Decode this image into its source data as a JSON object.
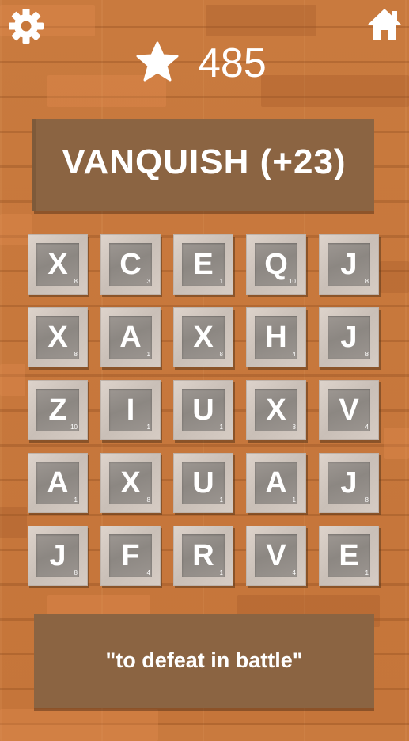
{
  "header": {
    "score": "485"
  },
  "word": {
    "text": "VANQUISH (+23)"
  },
  "hint": {
    "text": "\"to defeat in battle\""
  },
  "grid": [
    [
      {
        "letter": "X",
        "points": "8"
      },
      {
        "letter": "C",
        "points": "3"
      },
      {
        "letter": "E",
        "points": "1"
      },
      {
        "letter": "Q",
        "points": "10"
      },
      {
        "letter": "J",
        "points": "8"
      }
    ],
    [
      {
        "letter": "X",
        "points": "8"
      },
      {
        "letter": "A",
        "points": "1"
      },
      {
        "letter": "X",
        "points": "8"
      },
      {
        "letter": "H",
        "points": "4"
      },
      {
        "letter": "J",
        "points": "8"
      }
    ],
    [
      {
        "letter": "Z",
        "points": "10"
      },
      {
        "letter": "I",
        "points": "1"
      },
      {
        "letter": "U",
        "points": "1"
      },
      {
        "letter": "X",
        "points": "8"
      },
      {
        "letter": "V",
        "points": "4"
      }
    ],
    [
      {
        "letter": "A",
        "points": "1"
      },
      {
        "letter": "X",
        "points": "8"
      },
      {
        "letter": "U",
        "points": "1"
      },
      {
        "letter": "A",
        "points": "1"
      },
      {
        "letter": "J",
        "points": "8"
      }
    ],
    [
      {
        "letter": "J",
        "points": "8"
      },
      {
        "letter": "F",
        "points": "4"
      },
      {
        "letter": "R",
        "points": "1"
      },
      {
        "letter": "V",
        "points": "4"
      },
      {
        "letter": "E",
        "points": "1"
      }
    ]
  ],
  "colors": {
    "background": "#c7783b",
    "board": "#8b6442",
    "tile": "#d6ccc4",
    "tile_inner": "#938d88",
    "text": "#ffffff"
  },
  "icons": {
    "settings": "gear-icon",
    "home": "home-icon",
    "score": "star-icon"
  }
}
